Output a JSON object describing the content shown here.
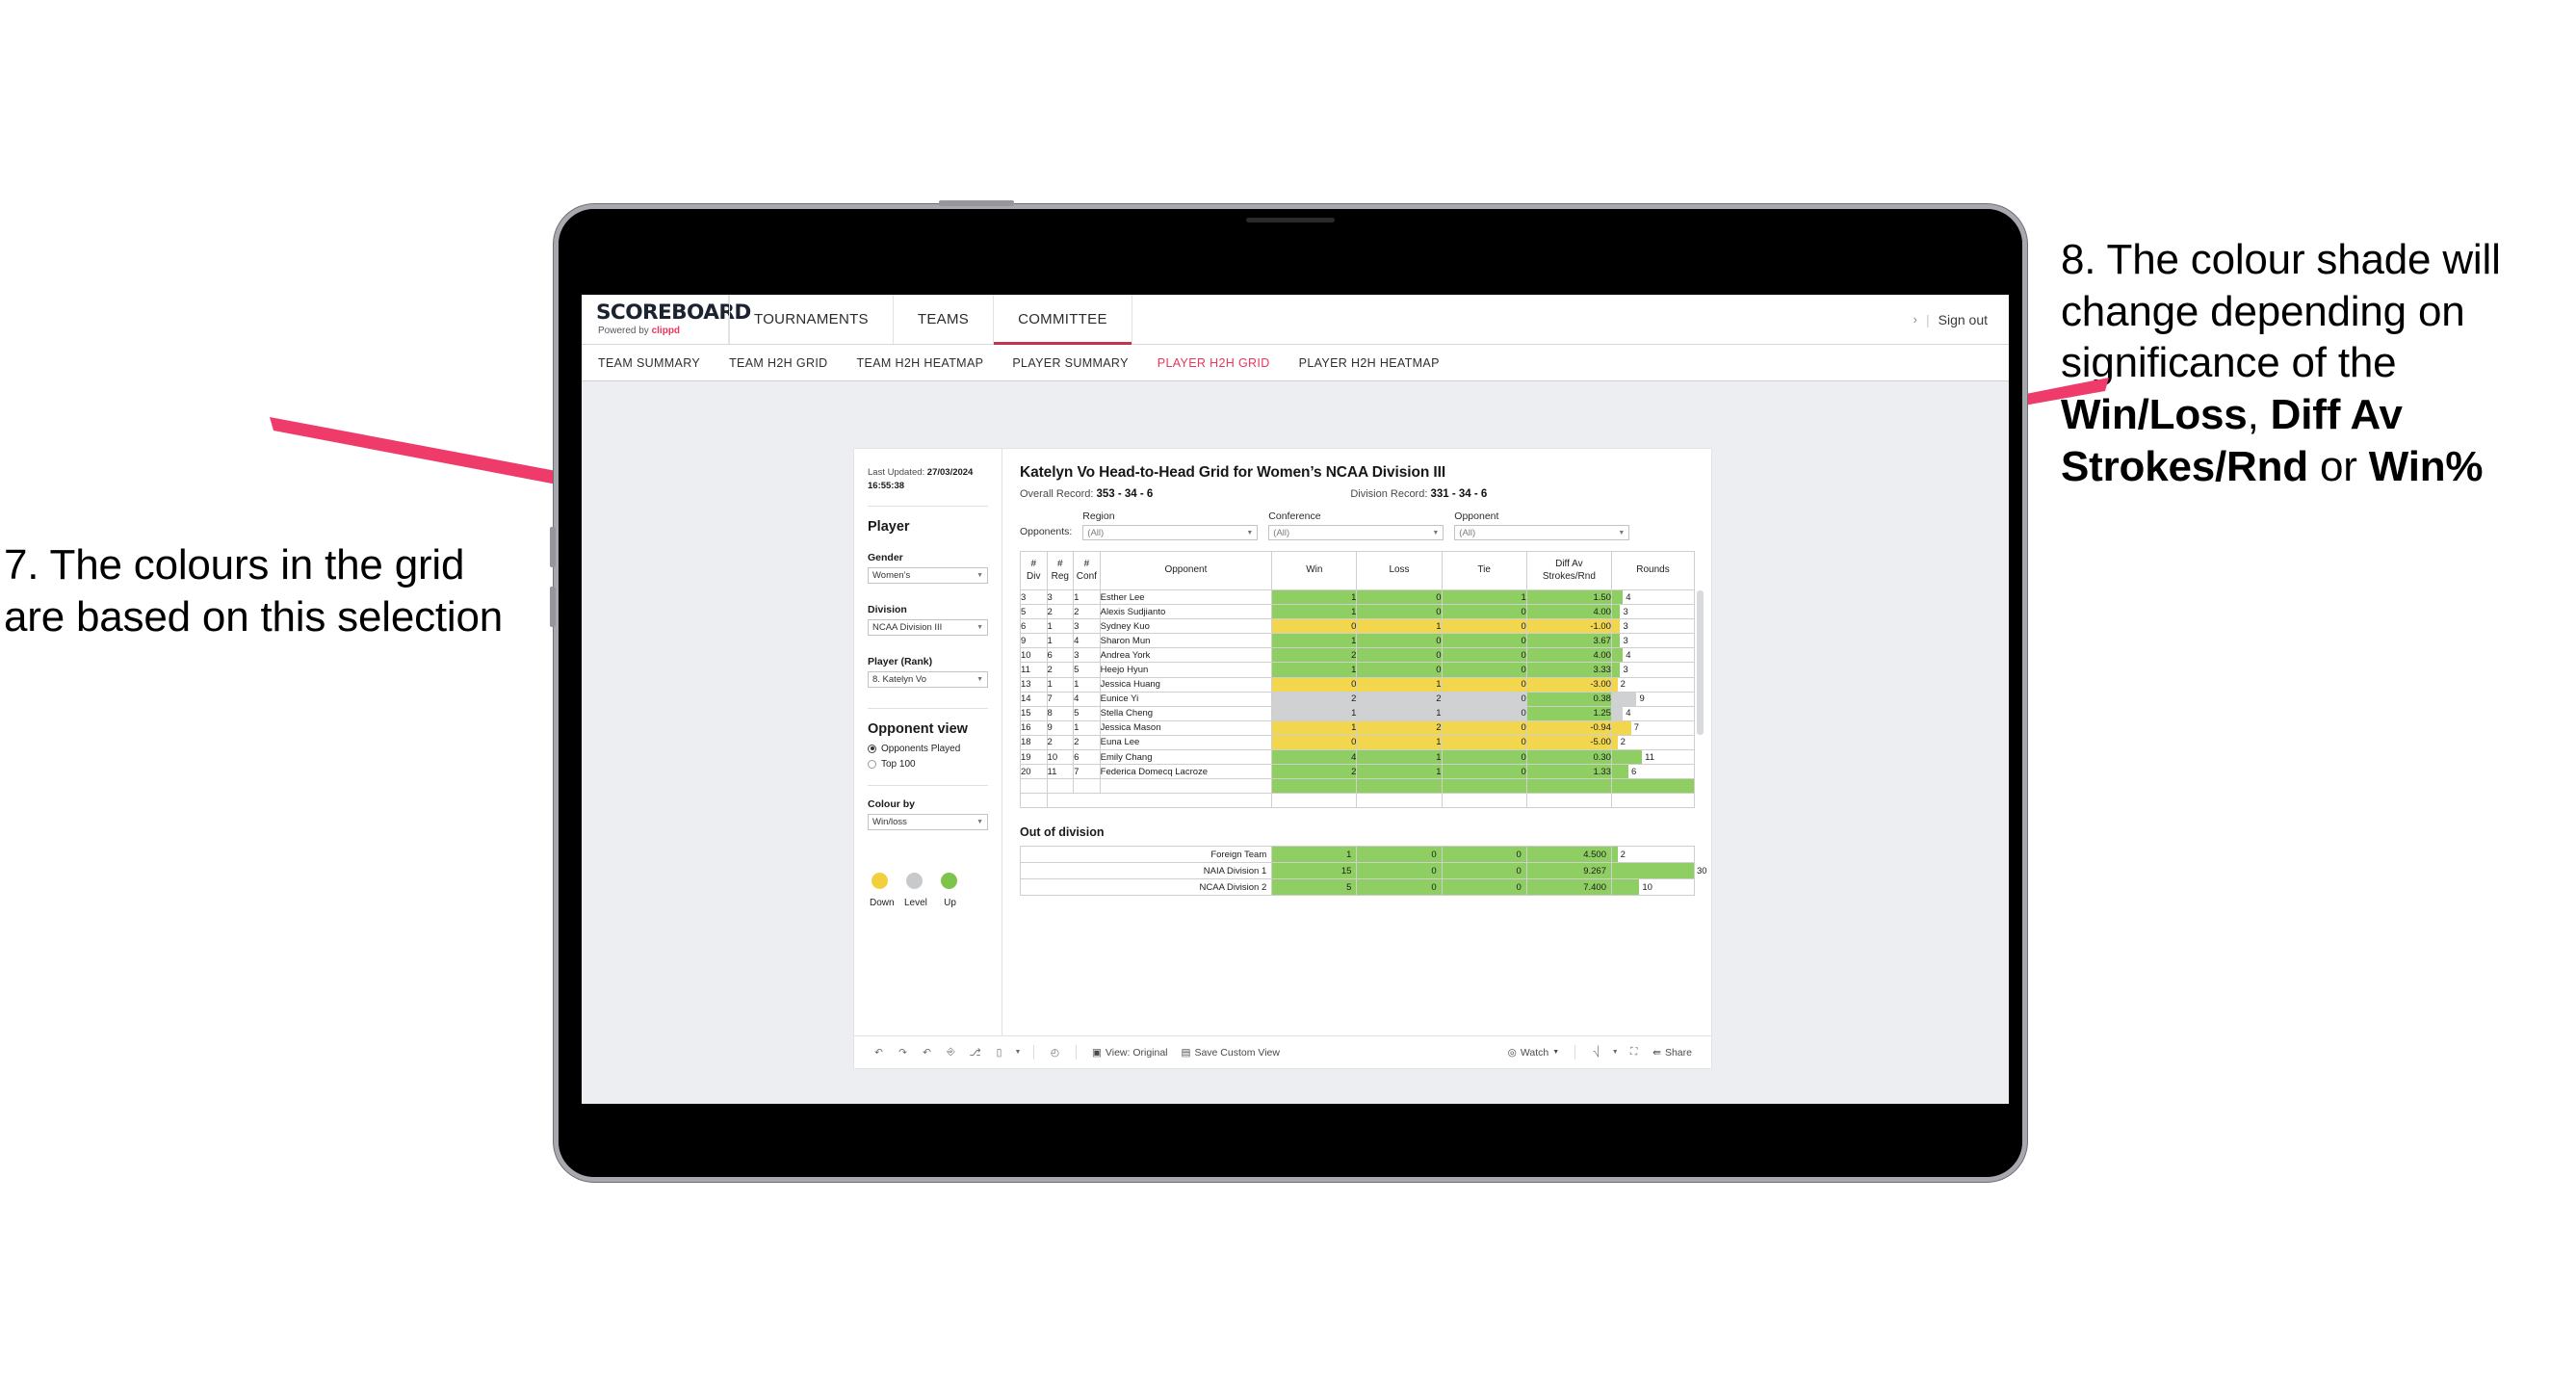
{
  "annotations": {
    "left": "7. The colours in the grid are based on this selection",
    "right_parts": [
      {
        "t": "8. The colour shade will change depending on significance of the ",
        "b": false
      },
      {
        "t": "Win/Loss",
        "b": true
      },
      {
        "t": ", ",
        "b": false
      },
      {
        "t": "Diff Av Strokes/Rnd",
        "b": true
      },
      {
        "t": " or ",
        "b": false
      },
      {
        "t": "Win%",
        "b": true
      }
    ],
    "arrow_color": "#ef3b69"
  },
  "app": {
    "logo_main": "SCOREBOARD",
    "logo_sub_prefix": "Powered by ",
    "logo_sub_brand": "clippd",
    "nav": [
      {
        "label": "TOURNAMENTS",
        "active": false
      },
      {
        "label": "TEAMS",
        "active": false
      },
      {
        "label": "COMMITTEE",
        "active": true
      }
    ],
    "chevron": "›",
    "divider": "|",
    "sign_out": "Sign out",
    "subtabs": [
      {
        "label": "TEAM SUMMARY",
        "active": false
      },
      {
        "label": "TEAM H2H GRID",
        "active": false
      },
      {
        "label": "TEAM H2H HEATMAP",
        "active": false
      },
      {
        "label": "PLAYER SUMMARY",
        "active": false
      },
      {
        "label": "PLAYER H2H GRID",
        "active": true
      },
      {
        "label": "PLAYER H2H HEATMAP",
        "active": false
      }
    ],
    "accent": "#e8365d"
  },
  "panel": {
    "last_updated_label": "Last Updated: ",
    "last_updated_value": "27/03/2024",
    "last_updated_time": "16:55:38",
    "heading": "Player",
    "fields": [
      {
        "label": "Gender",
        "value": "Women’s"
      },
      {
        "label": "Division",
        "value": "NCAA Division III"
      },
      {
        "label": "Player (Rank)",
        "value": "8. Katelyn Vo"
      }
    ],
    "opponent_view_heading": "Opponent view",
    "opponent_view_options": [
      {
        "label": "Opponents Played",
        "selected": true
      },
      {
        "label": "Top 100",
        "selected": false
      }
    ],
    "colour_by_label": "Colour by",
    "colour_by_value": "Win/loss",
    "legend": [
      {
        "label": "Down",
        "color": "#f2d03c"
      },
      {
        "label": "Level",
        "color": "#c7c9cb"
      },
      {
        "label": "Up",
        "color": "#7dc44b"
      }
    ]
  },
  "view": {
    "title": "Katelyn Vo Head-to-Head Grid for Women’s NCAA Division III",
    "overall_label": "Overall Record: ",
    "overall_value": "353 -  34 - 6",
    "division_label": "Division Record: ",
    "division_value": "331 -  34 - 6",
    "opponents_label": "Opponents:",
    "filters": [
      {
        "label": "Region",
        "value": "(All)"
      },
      {
        "label": "Conference",
        "value": "(All)"
      },
      {
        "label": "Opponent",
        "value": "(All)"
      }
    ]
  },
  "chart_data": {
    "type": "table",
    "title": "Katelyn Vo Head-to-Head Grid for Women’s NCAA Division III",
    "columns": [
      "# Div",
      "# Reg",
      "# Conf",
      "Opponent",
      "Win",
      "Loss",
      "Tie",
      "Diff Av Strokes/Rnd",
      "Rounds"
    ],
    "column_header_lines": [
      [
        "#",
        "Div"
      ],
      [
        "#",
        "Reg"
      ],
      [
        "#",
        "Conf"
      ],
      [
        "Opponent"
      ],
      [
        "Win"
      ],
      [
        "Loss"
      ],
      [
        "Tie"
      ],
      [
        "Diff Av",
        "Strokes/Rnd"
      ],
      [
        "Rounds"
      ]
    ],
    "colors": {
      "up": "#8fce63",
      "down": "#f2d64e",
      "level": "#cfd1d3"
    },
    "rounds_max": 30,
    "rows": [
      {
        "div": "3",
        "reg": "3",
        "conf": "1",
        "opponent": "Esther Lee",
        "win": "1",
        "loss": "0",
        "tie": "1",
        "diff": "1.50",
        "rounds": 4,
        "state": "up",
        "diff_state": "up"
      },
      {
        "div": "5",
        "reg": "2",
        "conf": "2",
        "opponent": "Alexis Sudjianto",
        "win": "1",
        "loss": "0",
        "tie": "0",
        "diff": "4.00",
        "rounds": 3,
        "state": "up",
        "diff_state": "up"
      },
      {
        "div": "6",
        "reg": "1",
        "conf": "3",
        "opponent": "Sydney Kuo",
        "win": "0",
        "loss": "1",
        "tie": "0",
        "diff": "-1.00",
        "rounds": 3,
        "state": "down",
        "diff_state": "down"
      },
      {
        "div": "9",
        "reg": "1",
        "conf": "4",
        "opponent": "Sharon Mun",
        "win": "1",
        "loss": "0",
        "tie": "0",
        "diff": "3.67",
        "rounds": 3,
        "state": "up",
        "diff_state": "up"
      },
      {
        "div": "10",
        "reg": "6",
        "conf": "3",
        "opponent": "Andrea York",
        "win": "2",
        "loss": "0",
        "tie": "0",
        "diff": "4.00",
        "rounds": 4,
        "state": "up",
        "diff_state": "up"
      },
      {
        "div": "11",
        "reg": "2",
        "conf": "5",
        "opponent": "Heejo Hyun",
        "win": "1",
        "loss": "0",
        "tie": "0",
        "diff": "3.33",
        "rounds": 3,
        "state": "up",
        "diff_state": "up"
      },
      {
        "div": "13",
        "reg": "1",
        "conf": "1",
        "opponent": "Jessica Huang",
        "win": "0",
        "loss": "1",
        "tie": "0",
        "diff": "-3.00",
        "rounds": 2,
        "state": "down",
        "diff_state": "down"
      },
      {
        "div": "14",
        "reg": "7",
        "conf": "4",
        "opponent": "Eunice Yi",
        "win": "2",
        "loss": "2",
        "tie": "0",
        "diff": "0.38",
        "rounds": 9,
        "state": "level",
        "diff_state": "up"
      },
      {
        "div": "15",
        "reg": "8",
        "conf": "5",
        "opponent": "Stella Cheng",
        "win": "1",
        "loss": "1",
        "tie": "0",
        "diff": "1.25",
        "rounds": 4,
        "state": "level",
        "diff_state": "up"
      },
      {
        "div": "16",
        "reg": "9",
        "conf": "1",
        "opponent": "Jessica Mason",
        "win": "1",
        "loss": "2",
        "tie": "0",
        "diff": "-0.94",
        "rounds": 7,
        "state": "down",
        "diff_state": "down"
      },
      {
        "div": "18",
        "reg": "2",
        "conf": "2",
        "opponent": "Euna Lee",
        "win": "0",
        "loss": "1",
        "tie": "0",
        "diff": "-5.00",
        "rounds": 2,
        "state": "down",
        "diff_state": "down"
      },
      {
        "div": "19",
        "reg": "10",
        "conf": "6",
        "opponent": "Emily Chang",
        "win": "4",
        "loss": "1",
        "tie": "0",
        "diff": "0.30",
        "rounds": 11,
        "state": "up",
        "diff_state": "up"
      },
      {
        "div": "20",
        "reg": "11",
        "conf": "7",
        "opponent": "Federica Domecq Lacroze",
        "win": "2",
        "loss": "1",
        "tie": "0",
        "diff": "1.33",
        "rounds": 6,
        "state": "up",
        "diff_state": "up"
      }
    ],
    "out_of_division": {
      "title": "Out of division",
      "rows": [
        {
          "label": "Foreign Team",
          "win": "1",
          "loss": "0",
          "tie": "0",
          "diff": "4.500",
          "rounds": 2,
          "state": "up"
        },
        {
          "label": "NAIA Division 1",
          "win": "15",
          "loss": "0",
          "tie": "0",
          "diff": "9.267",
          "rounds": 30,
          "state": "up"
        },
        {
          "label": "NCAA Division 2",
          "win": "5",
          "loss": "0",
          "tie": "0",
          "diff": "7.400",
          "rounds": 10,
          "state": "up"
        }
      ]
    }
  },
  "toolbar": {
    "icons": [
      "undo-icon",
      "redo-icon",
      "revert-icon",
      "refresh-icon",
      "pause-icon",
      "highlight-icon"
    ],
    "view_label": "View: Original",
    "save_label": "Save Custom View",
    "watch_label": "Watch",
    "share_label": "Share"
  }
}
